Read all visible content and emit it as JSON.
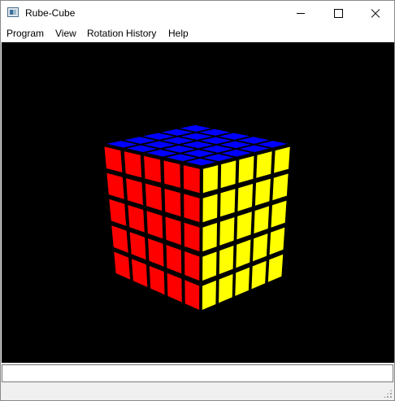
{
  "window": {
    "title": "Rube-Cube",
    "icon": "app-icon",
    "controls": [
      "minimize-icon",
      "maximize-icon",
      "close-icon"
    ]
  },
  "menu": {
    "program": "Program",
    "view": "View",
    "rotation_history": "Rotation History",
    "help": "Help"
  },
  "cube": {
    "size": 5,
    "background": "#000000",
    "faces": {
      "top": "#0000ff",
      "left": "#ff0000",
      "right": "#ffff00"
    },
    "grid_color": "#000000"
  },
  "status": {
    "input_value": ""
  }
}
